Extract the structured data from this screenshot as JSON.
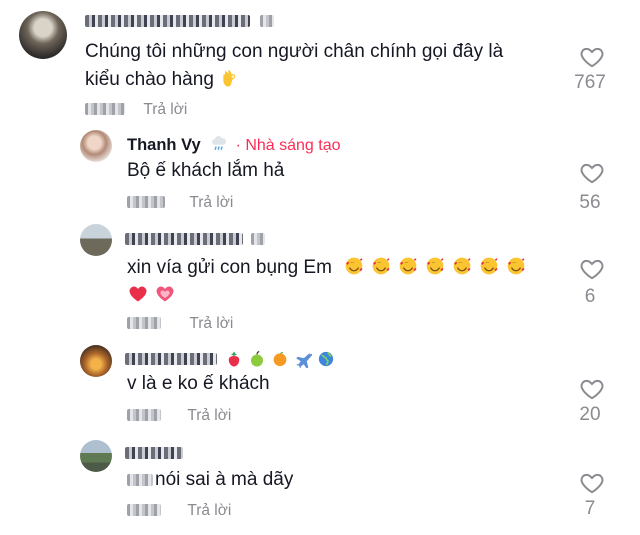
{
  "comments": [
    {
      "text_line1": "Chúng tôi những con người chân chính gọi đây là",
      "text_line2": "kiểu chào hàng",
      "emoji_icon": "ok-hand-icon",
      "reply_label": "Trả lời",
      "likes": "767"
    },
    {
      "name": "Thanh Vy",
      "creator_label": "· Nhà sáng tạo",
      "badge_icon": "rain-cloud-icon",
      "text": "Bộ ế khách lắm hả",
      "reply_label": "Trả lời",
      "likes": "56"
    },
    {
      "text": "xin vía gửi con bụng Em",
      "emoji_icons": [
        "smiling-face-with-hearts-icon",
        "red-heart-icon",
        "growing-heart-icon"
      ],
      "reply_label": "Trả lời",
      "likes": "6"
    },
    {
      "name_emoji_icons": [
        "strawberry-icon",
        "green-apple-icon",
        "orange-icon",
        "airplane-icon",
        "globe-icon"
      ],
      "text": "v là e ko ế khách",
      "reply_label": "Trả lời",
      "likes": "20"
    },
    {
      "text": "nói sai à mà dãy",
      "reply_label": "Trả lời",
      "likes": "7"
    }
  ],
  "colors": {
    "creator": "#fe2c55",
    "muted": "#8a8b91",
    "text": "#161823"
  }
}
